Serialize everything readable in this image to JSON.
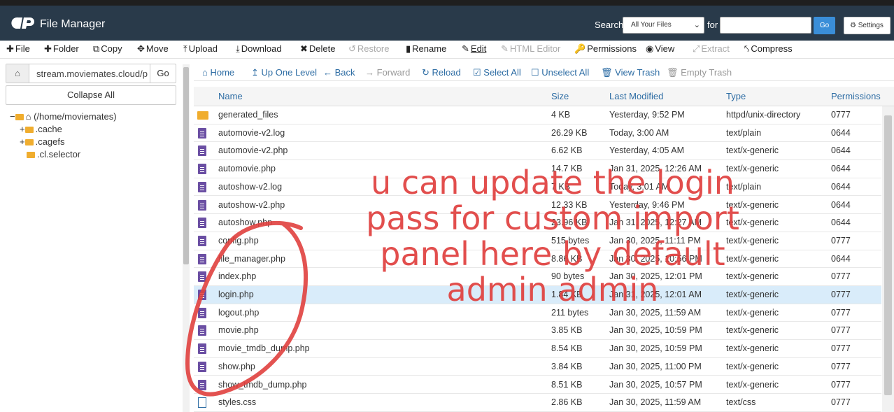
{
  "header": {
    "app_title": "File Manager",
    "search_label": "Search",
    "search_scope": "All Your Files",
    "for_label": "for",
    "search_value": "",
    "go_label": "Go",
    "settings_label": "Settings"
  },
  "toolbar": {
    "file": "File",
    "folder": "Folder",
    "copy": "Copy",
    "move": "Move",
    "upload": "Upload",
    "download": "Download",
    "delete": "Delete",
    "restore": "Restore",
    "rename": "Rename",
    "edit": "Edit",
    "html_editor": "HTML Editor",
    "permissions": "Permissions",
    "view": "View",
    "extract": "Extract",
    "compress": "Compress"
  },
  "sidebar": {
    "path": "stream.moviemates.cloud/p",
    "go_label": "Go",
    "collapse_all": "Collapse All",
    "tree": {
      "root": "(/home/moviemates)",
      "items": [
        ".cache",
        ".cagefs",
        ".cl.selector"
      ]
    }
  },
  "nav": {
    "home": "Home",
    "up_one_level": "Up One Level",
    "back": "Back",
    "forward": "Forward",
    "reload": "Reload",
    "select_all": "Select All",
    "unselect_all": "Unselect All",
    "view_trash": "View Trash",
    "empty_trash": "Empty Trash"
  },
  "table": {
    "headers": {
      "name": "Name",
      "size": "Size",
      "modified": "Last Modified",
      "type": "Type",
      "permissions": "Permissions"
    },
    "rows": [
      {
        "name": "generated_files",
        "size": "4 KB",
        "modified": "Yesterday, 9:52 PM",
        "type": "httpd/unix-directory",
        "perm": "0777",
        "kind": "dir"
      },
      {
        "name": "automovie-v2.log",
        "size": "26.29 KB",
        "modified": "Today, 3:00 AM",
        "type": "text/plain",
        "perm": "0644",
        "kind": "file"
      },
      {
        "name": "automovie-v2.php",
        "size": "6.62 KB",
        "modified": "Yesterday, 4:05 AM",
        "type": "text/x-generic",
        "perm": "0644",
        "kind": "file"
      },
      {
        "name": "automovie.php",
        "size": "14.7 KB",
        "modified": "Jan 31, 2025, 12:26 AM",
        "type": "text/x-generic",
        "perm": "0644",
        "kind": "file"
      },
      {
        "name": "autoshow-v2.log",
        "size": "7 KB",
        "modified": "Today, 3:01 AM",
        "type": "text/plain",
        "perm": "0644",
        "kind": "file"
      },
      {
        "name": "autoshow-v2.php",
        "size": "12.33 KB",
        "modified": "Yesterday, 9:46 PM",
        "type": "text/x-generic",
        "perm": "0644",
        "kind": "file"
      },
      {
        "name": "autoshow.php",
        "size": "23.96 KB",
        "modified": "Jan 31, 2025, 12:27 AM",
        "type": "text/x-generic",
        "perm": "0644",
        "kind": "file"
      },
      {
        "name": "config.php",
        "size": "515 bytes",
        "modified": "Jan 30, 2025, 11:11 PM",
        "type": "text/x-generic",
        "perm": "0777",
        "kind": "file"
      },
      {
        "name": "file_manager.php",
        "size": "8.86 KB",
        "modified": "Jan 30, 2025, 10:56 PM",
        "type": "text/x-generic",
        "perm": "0644",
        "kind": "file"
      },
      {
        "name": "index.php",
        "size": "90 bytes",
        "modified": "Jan 30, 2025, 12:01 PM",
        "type": "text/x-generic",
        "perm": "0777",
        "kind": "file"
      },
      {
        "name": "login.php",
        "size": "1.84 KB",
        "modified": "Jan 31, 2025, 12:01 AM",
        "type": "text/x-generic",
        "perm": "0777",
        "kind": "file",
        "selected": true
      },
      {
        "name": "logout.php",
        "size": "211 bytes",
        "modified": "Jan 30, 2025, 11:59 AM",
        "type": "text/x-generic",
        "perm": "0777",
        "kind": "file"
      },
      {
        "name": "movie.php",
        "size": "3.85 KB",
        "modified": "Jan 30, 2025, 10:59 PM",
        "type": "text/x-generic",
        "perm": "0777",
        "kind": "file"
      },
      {
        "name": "movie_tmdb_dump.php",
        "size": "8.54 KB",
        "modified": "Jan 30, 2025, 10:59 PM",
        "type": "text/x-generic",
        "perm": "0777",
        "kind": "file"
      },
      {
        "name": "show.php",
        "size": "3.84 KB",
        "modified": "Jan 30, 2025, 11:00 PM",
        "type": "text/x-generic",
        "perm": "0777",
        "kind": "file"
      },
      {
        "name": "show_tmdb_dump.php",
        "size": "8.51 KB",
        "modified": "Jan 30, 2025, 10:57 PM",
        "type": "text/x-generic",
        "perm": "0777",
        "kind": "file"
      },
      {
        "name": "styles.css",
        "size": "2.86 KB",
        "modified": "Jan 30, 2025, 11:59 AM",
        "type": "text/css",
        "perm": "0777",
        "kind": "css"
      }
    ]
  },
  "annotation": {
    "line1": "u can update the login",
    "line2": "pass for custom import",
    "line3": "panel here by default",
    "line4": "admin admin",
    "color": "#e0403e"
  },
  "colors": {
    "header_bg": "#293a4a",
    "link": "#2e6da4",
    "selected_row": "#d9ecfa",
    "folder": "#f0ad2e",
    "file_icon": "#6b4fa3"
  }
}
